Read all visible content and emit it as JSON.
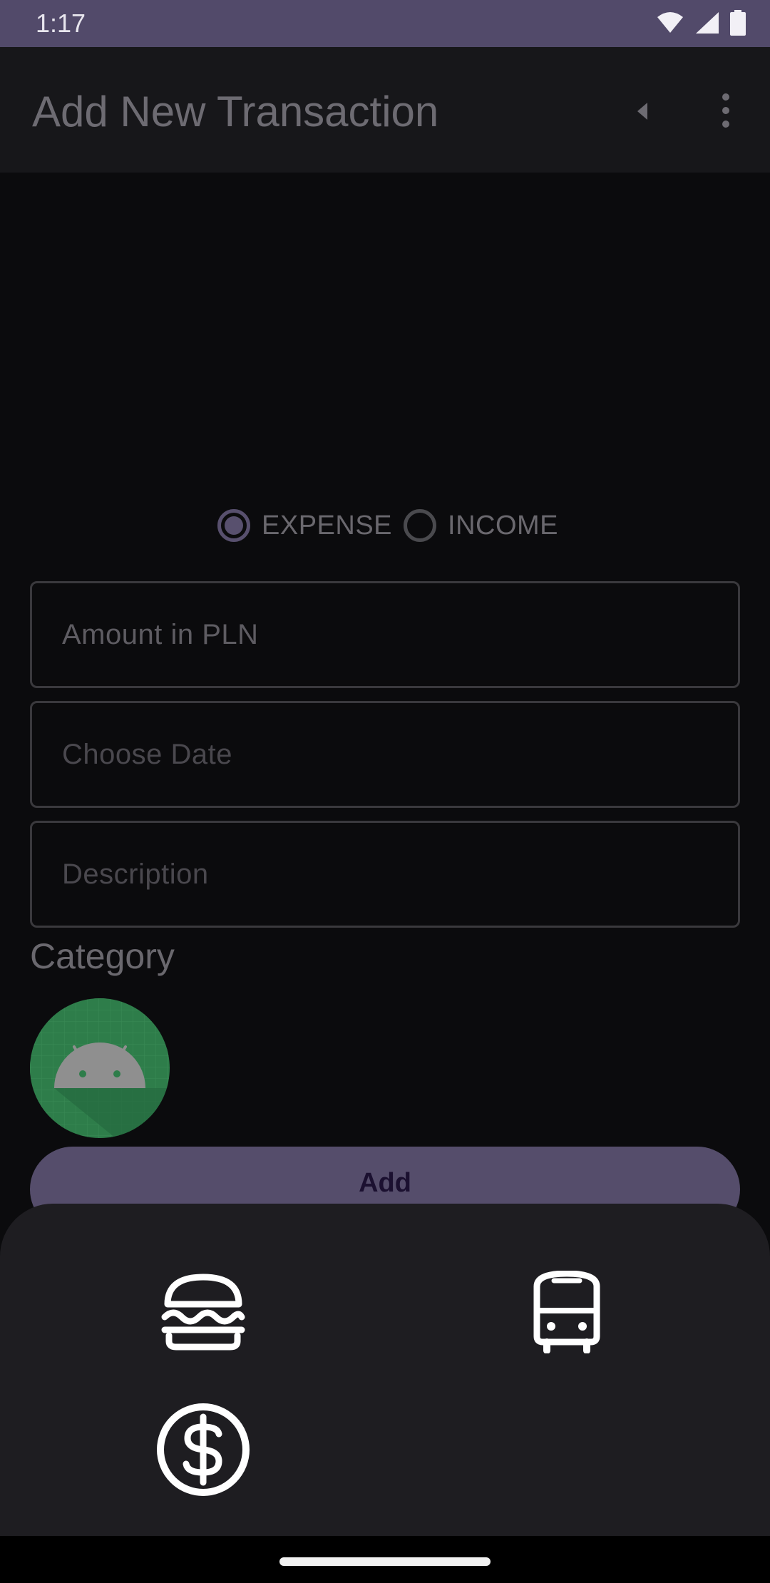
{
  "status_bar": {
    "time": "1:17",
    "icons": [
      "wifi-icon",
      "signal-icon",
      "battery-icon"
    ]
  },
  "app_bar": {
    "title": "Add New Transaction",
    "back_icon": "back-arrow-icon",
    "menu_icon": "overflow-menu-icon"
  },
  "form": {
    "type_options": [
      {
        "label": "EXPENSE",
        "selected": true
      },
      {
        "label": "INCOME",
        "selected": false
      }
    ],
    "amount_field": {
      "value": "Amount in PLN"
    },
    "date_field": {
      "placeholder": "Choose Date"
    },
    "description_field": {
      "placeholder": "Description"
    },
    "category_label": "Category",
    "add_button_label": "Add"
  },
  "category_sheet": {
    "options": [
      {
        "icon": "hamburger-icon",
        "category": "food"
      },
      {
        "icon": "bus-icon",
        "category": "transport"
      },
      {
        "icon": "dollar-coin-icon",
        "category": "money"
      }
    ]
  },
  "colors": {
    "status_bar": "#524a6a",
    "accent": "#554d6b",
    "sheet_background": "#1e1d21",
    "avatar_green": "#2e7d4a"
  }
}
